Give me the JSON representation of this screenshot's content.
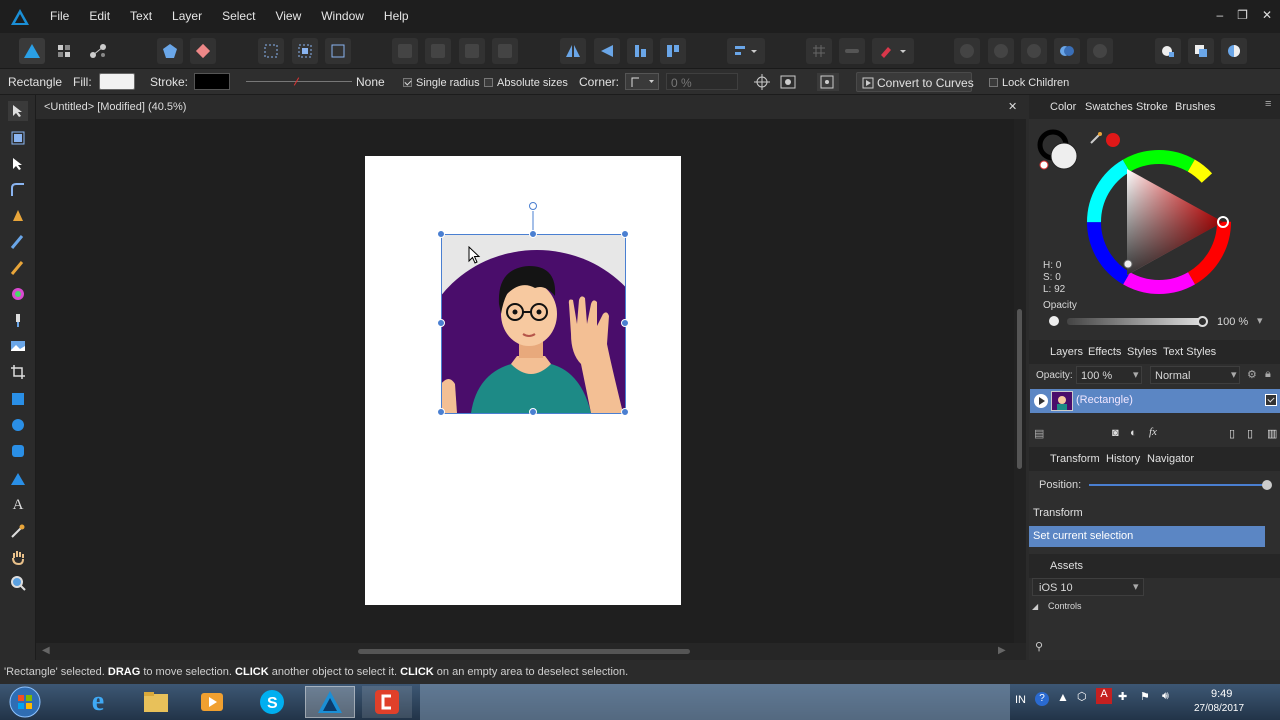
{
  "app": {
    "name": "Affinity Designer",
    "accent": "#4a7fd1"
  },
  "menu": [
    "File",
    "Edit",
    "Text",
    "Layer",
    "Select",
    "View",
    "Window",
    "Help"
  ],
  "window_controls": {
    "minimize": "–",
    "restore": "❐",
    "close": "✕"
  },
  "context_bar": {
    "shape": "Rectangle",
    "fill_label": "Fill:",
    "fill_color": "#f2f2f2",
    "stroke_label": "Stroke:",
    "stroke_color": "#000000",
    "stroke_style_value": "None",
    "single_radius_label": "Single radius",
    "single_radius_checked": true,
    "absolute_sizes_label": "Absolute sizes",
    "absolute_sizes_checked": false,
    "corner_label": "Corner:",
    "corner_value": "0 %",
    "convert_label": "Convert to Curves",
    "lock_children_label": "Lock Children"
  },
  "document": {
    "tab_title": "<Untitled> [Modified] (40.5%)",
    "close": "✕"
  },
  "color_panel": {
    "tabs": [
      "Color",
      "Swatches",
      "Stroke",
      "Brushes"
    ],
    "h": "H: 0",
    "s": "S: 0",
    "l": "L: 92",
    "opacity_label": "Opacity",
    "opacity_value": "100 %"
  },
  "layers_panel": {
    "tabs": [
      "Layers",
      "Effects",
      "Styles",
      "Text Styles"
    ],
    "opacity_label": "Opacity:",
    "opacity_value": "100 %",
    "blend_mode": "Normal",
    "layer_name": "(Rectangle)"
  },
  "history_panel": {
    "tabs": [
      "Transform",
      "History",
      "Navigator"
    ],
    "position_label": "Position:",
    "items": [
      "Transform",
      "Set current selection"
    ],
    "selected_index": 1
  },
  "assets_panel": {
    "title": "Assets",
    "category": "iOS 10",
    "group": "Controls"
  },
  "status": {
    "parts": [
      {
        "text": "'Rectangle' selected. ",
        "bold": false
      },
      {
        "text": "DRAG",
        "bold": true
      },
      {
        "text": " to move selection. ",
        "bold": false
      },
      {
        "text": "CLICK",
        "bold": true
      },
      {
        "text": " another object to select it. ",
        "bold": false
      },
      {
        "text": "CLICK",
        "bold": true
      },
      {
        "text": " on an empty area to deselect selection.",
        "bold": false
      }
    ]
  },
  "taskbar": {
    "lang": "IN",
    "time": "9:49",
    "date": "27/08/2017"
  }
}
